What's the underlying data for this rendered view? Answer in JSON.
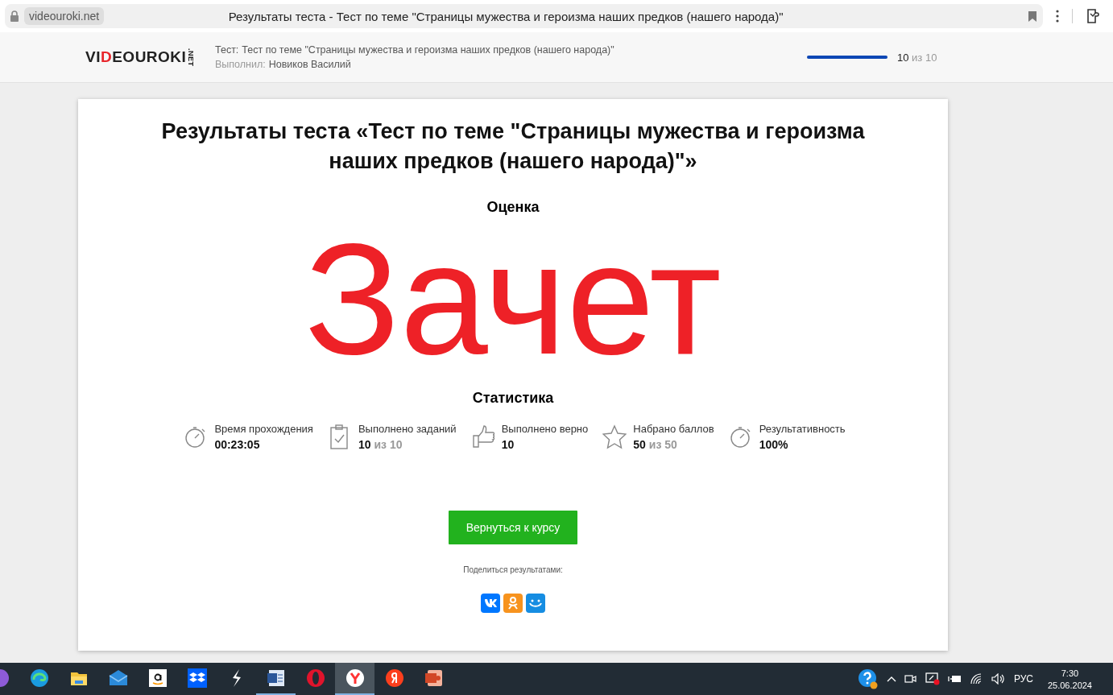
{
  "browser": {
    "address": "videouroki.net",
    "page_title": "Результаты теста - Тест по теме \"Страницы мужества и героизма наших предков (нашего народа)\""
  },
  "header": {
    "logo": {
      "before": "VI",
      "accent": "D",
      "after": "EOUROKI",
      "suffix": ".NET"
    },
    "test_label": "Тест:",
    "test_name": "Тест по теме \"Страницы мужества и героизма наших предков (нашего народа)\"",
    "author_label": "Выполнил:",
    "author_name": "Новиков Василий",
    "progress": {
      "level": 1,
      "current": "10",
      "total": "из 10"
    }
  },
  "result": {
    "title": "Результаты теста «Тест по теме \"Страницы мужества и героизма наших предков (нашего народа)\"»",
    "grade_label": "Оценка",
    "grade": "Зачет",
    "stats_title": "Статистика",
    "stats": [
      {
        "kind": "stopwatch",
        "label": "Время прохождения",
        "value": "00:23:05"
      },
      {
        "kind": "clipboard",
        "label": "Выполнено заданий",
        "value": "10",
        "suffix": "из 10"
      },
      {
        "kind": "thumb",
        "label": "Выполнено верно",
        "value": "10"
      },
      {
        "kind": "star",
        "label": "Набрано баллов",
        "value": "50",
        "suffix": "из 50"
      },
      {
        "kind": "stopwatch",
        "label": "Результативность",
        "value": "100%"
      }
    ],
    "back_button": "Вернуться к курсу",
    "share_label": "Поделиться результатами:",
    "share": [
      {
        "kind": "vk",
        "color": "#0077ff"
      },
      {
        "kind": "ok",
        "color": "#f7931e"
      },
      {
        "kind": "mail",
        "color": "#168de2"
      }
    ]
  },
  "taskbar": {
    "apps": [
      {
        "kind": "purple",
        "running": false,
        "selected": false
      },
      {
        "kind": "edge",
        "running": false,
        "selected": false
      },
      {
        "kind": "folder",
        "running": false,
        "selected": false
      },
      {
        "kind": "mail",
        "running": false,
        "selected": false
      },
      {
        "kind": "amazon",
        "running": false,
        "selected": false
      },
      {
        "kind": "dropbox",
        "running": false,
        "selected": false
      },
      {
        "kind": "bolt",
        "running": false,
        "selected": false
      },
      {
        "kind": "word",
        "running": true,
        "selected": false
      },
      {
        "kind": "opera",
        "running": false,
        "selected": false
      },
      {
        "kind": "ybrowser",
        "running": true,
        "selected": true
      },
      {
        "kind": "yandex",
        "running": false,
        "selected": false
      },
      {
        "kind": "slides",
        "running": false,
        "selected": false
      }
    ],
    "language": "РУС",
    "time": "7:30",
    "date": "25.06.2024"
  }
}
